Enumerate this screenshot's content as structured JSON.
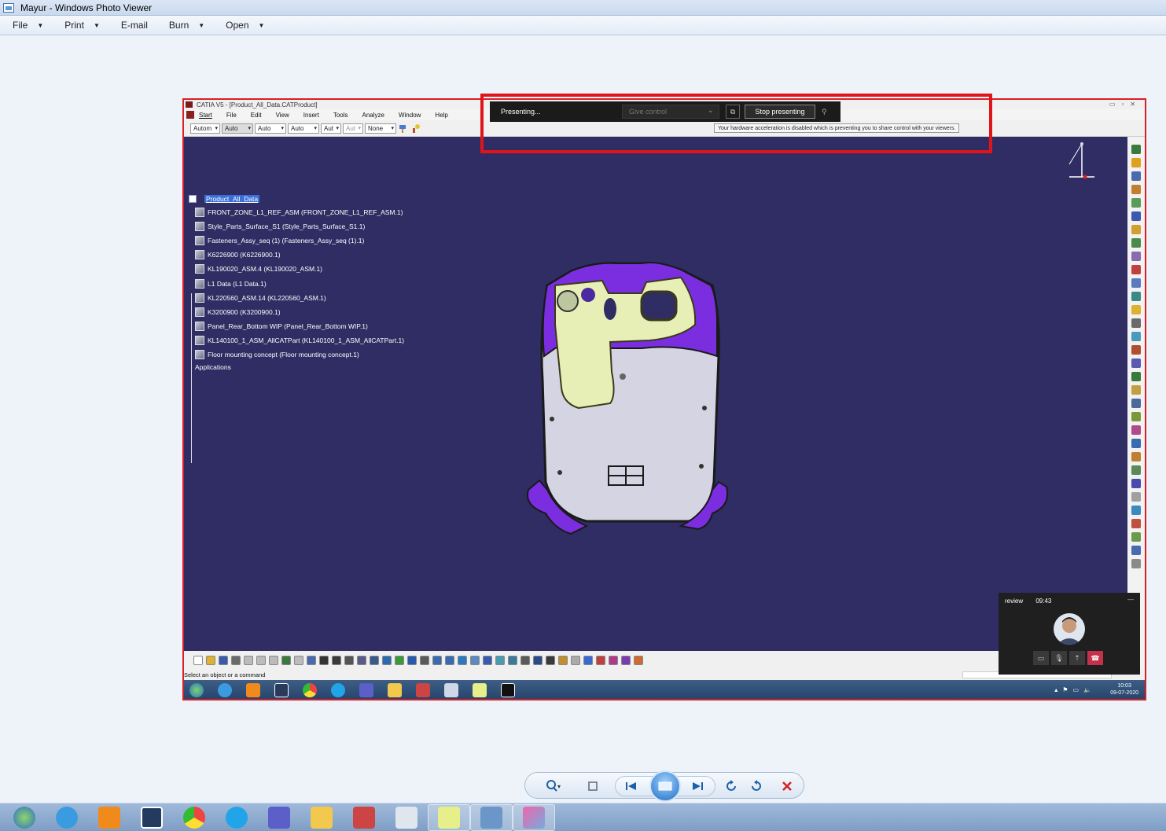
{
  "window": {
    "title": "Mayur - Windows Photo Viewer"
  },
  "menu": {
    "items": [
      {
        "label": "File",
        "has_dropdown": true
      },
      {
        "label": "Print",
        "has_dropdown": true
      },
      {
        "label": "E-mail",
        "has_dropdown": false
      },
      {
        "label": "Burn",
        "has_dropdown": true
      },
      {
        "label": "Open",
        "has_dropdown": true
      }
    ]
  },
  "screenshot": {
    "catia": {
      "title": "CATIA V5 - [Product_All_Data.CATProduct]",
      "menus": [
        "Start",
        "File",
        "Edit",
        "View",
        "Insert",
        "Tools",
        "Analyze",
        "Window",
        "Help"
      ],
      "toolbar_selects": [
        "Autom",
        "Auto",
        "Auto",
        "Auto",
        "Aut",
        "Aut",
        "None"
      ],
      "tree": {
        "root": "Product_All_Data",
        "items": [
          "FRONT_ZONE_L1_REF_ASM (FRONT_ZONE_L1_REF_ASM.1)",
          "Style_Parts_Surface_S1 (Style_Parts_Surface_S1.1)",
          "Fasteners_Assy_seq (1) (Fasteners_Assy_seq (1).1)",
          "K6226900 (K6226900.1)",
          "KL190020_ASM.4 (KL190020_ASM.1)",
          "L1 Data (L1 Data.1)",
          "KL220560_ASM.14 (KL220560_ASM.1)",
          "K3200900 (K3200900.1)",
          "Panel_Rear_Bottom WIP (Panel_Rear_Bottom WIP.1)",
          "KL140100_1_ASM_AllCATPart (KL140100_1_ASM_AllCATPart.1)",
          "Floor mounting concept (Floor mounting concept.1)"
        ],
        "footer": "Applications"
      },
      "status_text": "Select an object or a command"
    },
    "presenting_bar": {
      "status": "Presenting...",
      "give_control": "Give control",
      "stop_label": "Stop presenting",
      "tooltip": "Your hardware acceleration is disabled which is preventing you to share control with your viewers."
    },
    "call": {
      "name": "review",
      "timer": "09:43"
    },
    "inner_clock": {
      "time": "10:03",
      "date": "09-07-2020"
    }
  },
  "colors": {
    "highlight_border": "#e1141a",
    "catia_background": "#2f2d63",
    "part_purple": "#7a2ee0",
    "part_yellow": "#e8efb6",
    "part_silver": "#d4d4e2"
  }
}
